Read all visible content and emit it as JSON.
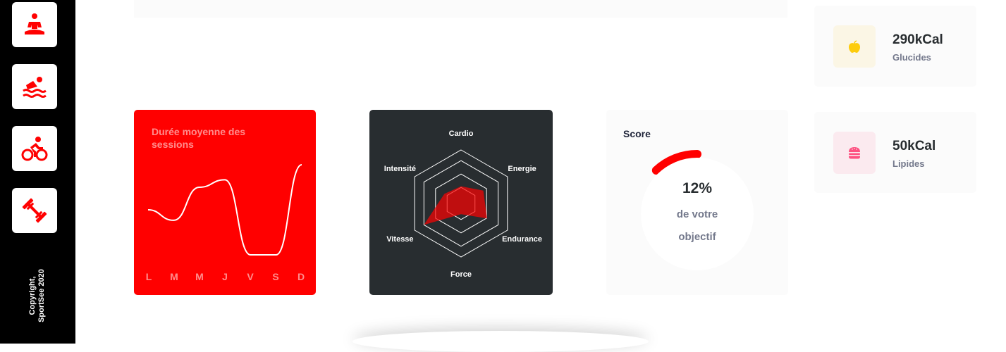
{
  "sidebar": {
    "icons": [
      "meditation-icon",
      "swimming-icon",
      "cycling-icon",
      "dumbbell-icon"
    ],
    "copyright_line1": "Copyright,",
    "copyright_line2": "SportSee 2020"
  },
  "average_sessions": {
    "title": "Durée moyenne des sessions",
    "days": [
      "L",
      "M",
      "M",
      "J",
      "V",
      "S",
      "D"
    ],
    "chart_data": {
      "type": "line",
      "categories": [
        "L",
        "M",
        "M",
        "J",
        "V",
        "S",
        "D"
      ],
      "values": [
        30,
        23,
        45,
        50,
        0,
        0,
        60
      ],
      "title": "Durée moyenne des sessions"
    }
  },
  "performance": {
    "chart_data": {
      "type": "radar",
      "categories": [
        "Cardio",
        "Energie",
        "Endurance",
        "Force",
        "Vitesse",
        "Intensité"
      ],
      "values": [
        80,
        120,
        140,
        50,
        200,
        90
      ],
      "max": 250
    }
  },
  "score": {
    "title": "Score",
    "value": "12%",
    "line1": "de votre",
    "line2": "objectif",
    "fraction": 0.12,
    "color": "#ff0000"
  },
  "nutrition": [
    {
      "value": "290kCal",
      "label": "Glucides",
      "icon": "apple-icon",
      "icon_color": "#fdcc0c",
      "bg": "#fbf6e5"
    },
    {
      "value": "50kCal",
      "label": "Lipides",
      "icon": "burger-icon",
      "icon_color": "#fd5181",
      "bg": "#fbeaef"
    }
  ]
}
